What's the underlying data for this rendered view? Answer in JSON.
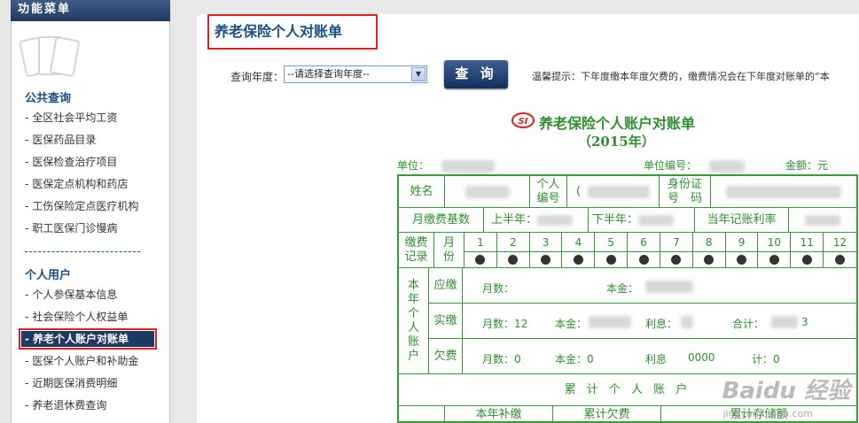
{
  "sidebar": {
    "header": "功能菜单",
    "sections": [
      {
        "title": "公共查询",
        "items": [
          "全区社会平均工资",
          "医保药品目录",
          "医保检查治疗项目",
          "医保定点机构和药店",
          "工伤保险定点医疗机构",
          "职工医保门诊慢病"
        ]
      },
      {
        "title": "个人用户",
        "items": [
          "个人参保基本信息",
          "社会保险个人权益单",
          "养老个人账户对账单",
          "医保个人账户和补助金",
          "近期医保消费明细",
          "养老退休费查询"
        ]
      }
    ],
    "active_item": "养老个人账户对账单"
  },
  "main": {
    "page_title": "养老保险个人对账单",
    "query_label": "查询年度：",
    "query_select_value": "--请选择查询年度--",
    "query_button": "查 询",
    "hint": "温馨提示：下年度缴本年度欠费的，缴费情况会在下年度对账单的“本"
  },
  "statement": {
    "logo": "SI",
    "title": "养老保险个人账户对账单",
    "year": "（2015年）",
    "unit_label": "单位：",
    "unit_code_label": "单位编号：",
    "amount_label": "金额：元",
    "name_label": "姓名",
    "id_label_1": "个人",
    "id_label_2": "编号",
    "idcard_label_1": "身份证",
    "idcard_label_2": "号　码",
    "monthly_base_label": "月缴费基数",
    "first_half_label": "上半年：",
    "second_half_label": "下半年：",
    "rate_label": "当年记账利率",
    "pay_record_1": "缴费",
    "pay_record_2": "记录",
    "month_label_1": "月",
    "month_label_2": "份",
    "months": [
      "1",
      "2",
      "3",
      "4",
      "5",
      "6",
      "7",
      "8",
      "9",
      "10",
      "11",
      "12"
    ],
    "account_label": [
      "本",
      "年",
      "个",
      "人",
      "账",
      "户"
    ],
    "due_label": "应缴",
    "paid_label": "实缴",
    "arrears_label": "欠费",
    "due_months": "月数：",
    "due_principal": "本金：",
    "paid_months": "月数：12",
    "paid_principal": "本金：",
    "paid_interest": "利息：",
    "paid_total": "合计：",
    "paid_total_tail": "3",
    "arrears_months": "月数：0",
    "arrears_principal": "本金：0",
    "arrears_interest": "利息",
    "arrears_interest_val": "0000",
    "arrears_total": "计：0",
    "cumulative_label": "累 计 个 人 账 户",
    "bottom_cols": [
      "本年补缴",
      "累计欠费",
      "累计存储额"
    ],
    "id_partial": "("
  },
  "watermark": {
    "brand": "Baidu 经验",
    "url": "jingyan.baidu.com"
  },
  "colors": {
    "accent_green": "#2f8f2f",
    "nav_blue": "#1d3a63",
    "highlight_red": "#e02020"
  }
}
